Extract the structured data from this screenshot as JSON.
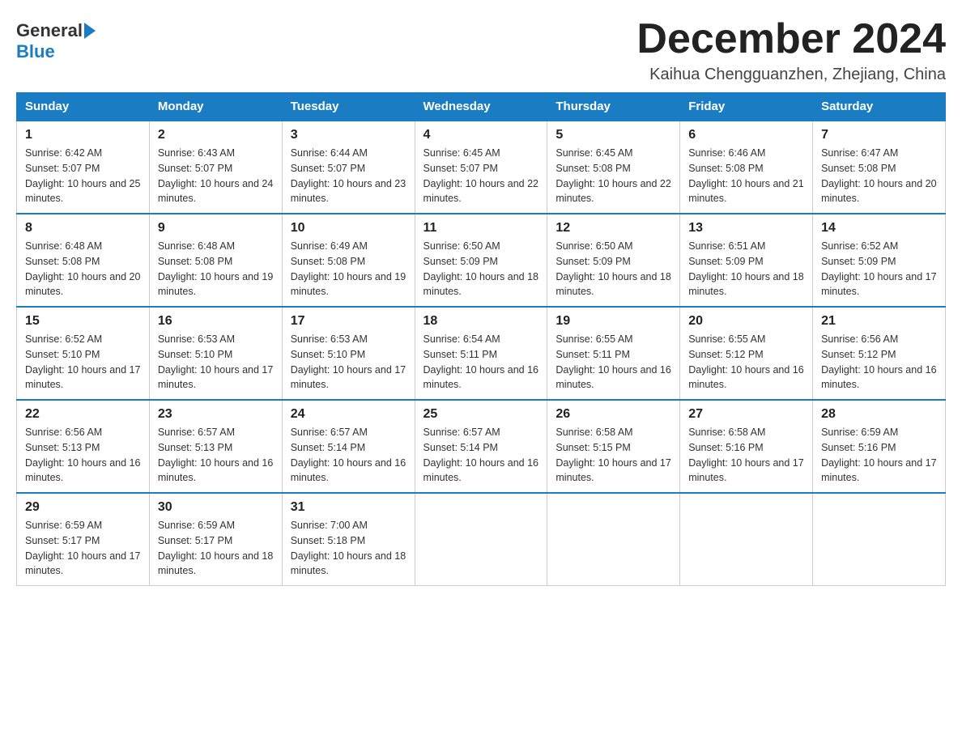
{
  "header": {
    "logo_general": "General",
    "logo_blue": "Blue",
    "month_title": "December 2024",
    "location": "Kaihua Chengguanzhen, Zhejiang, China"
  },
  "days_of_week": [
    "Sunday",
    "Monday",
    "Tuesday",
    "Wednesday",
    "Thursday",
    "Friday",
    "Saturday"
  ],
  "weeks": [
    [
      {
        "day": "1",
        "sunrise": "6:42 AM",
        "sunset": "5:07 PM",
        "daylight": "10 hours and 25 minutes."
      },
      {
        "day": "2",
        "sunrise": "6:43 AM",
        "sunset": "5:07 PM",
        "daylight": "10 hours and 24 minutes."
      },
      {
        "day": "3",
        "sunrise": "6:44 AM",
        "sunset": "5:07 PM",
        "daylight": "10 hours and 23 minutes."
      },
      {
        "day": "4",
        "sunrise": "6:45 AM",
        "sunset": "5:07 PM",
        "daylight": "10 hours and 22 minutes."
      },
      {
        "day": "5",
        "sunrise": "6:45 AM",
        "sunset": "5:08 PM",
        "daylight": "10 hours and 22 minutes."
      },
      {
        "day": "6",
        "sunrise": "6:46 AM",
        "sunset": "5:08 PM",
        "daylight": "10 hours and 21 minutes."
      },
      {
        "day": "7",
        "sunrise": "6:47 AM",
        "sunset": "5:08 PM",
        "daylight": "10 hours and 20 minutes."
      }
    ],
    [
      {
        "day": "8",
        "sunrise": "6:48 AM",
        "sunset": "5:08 PM",
        "daylight": "10 hours and 20 minutes."
      },
      {
        "day": "9",
        "sunrise": "6:48 AM",
        "sunset": "5:08 PM",
        "daylight": "10 hours and 19 minutes."
      },
      {
        "day": "10",
        "sunrise": "6:49 AM",
        "sunset": "5:08 PM",
        "daylight": "10 hours and 19 minutes."
      },
      {
        "day": "11",
        "sunrise": "6:50 AM",
        "sunset": "5:09 PM",
        "daylight": "10 hours and 18 minutes."
      },
      {
        "day": "12",
        "sunrise": "6:50 AM",
        "sunset": "5:09 PM",
        "daylight": "10 hours and 18 minutes."
      },
      {
        "day": "13",
        "sunrise": "6:51 AM",
        "sunset": "5:09 PM",
        "daylight": "10 hours and 18 minutes."
      },
      {
        "day": "14",
        "sunrise": "6:52 AM",
        "sunset": "5:09 PM",
        "daylight": "10 hours and 17 minutes."
      }
    ],
    [
      {
        "day": "15",
        "sunrise": "6:52 AM",
        "sunset": "5:10 PM",
        "daylight": "10 hours and 17 minutes."
      },
      {
        "day": "16",
        "sunrise": "6:53 AM",
        "sunset": "5:10 PM",
        "daylight": "10 hours and 17 minutes."
      },
      {
        "day": "17",
        "sunrise": "6:53 AM",
        "sunset": "5:10 PM",
        "daylight": "10 hours and 17 minutes."
      },
      {
        "day": "18",
        "sunrise": "6:54 AM",
        "sunset": "5:11 PM",
        "daylight": "10 hours and 16 minutes."
      },
      {
        "day": "19",
        "sunrise": "6:55 AM",
        "sunset": "5:11 PM",
        "daylight": "10 hours and 16 minutes."
      },
      {
        "day": "20",
        "sunrise": "6:55 AM",
        "sunset": "5:12 PM",
        "daylight": "10 hours and 16 minutes."
      },
      {
        "day": "21",
        "sunrise": "6:56 AM",
        "sunset": "5:12 PM",
        "daylight": "10 hours and 16 minutes."
      }
    ],
    [
      {
        "day": "22",
        "sunrise": "6:56 AM",
        "sunset": "5:13 PM",
        "daylight": "10 hours and 16 minutes."
      },
      {
        "day": "23",
        "sunrise": "6:57 AM",
        "sunset": "5:13 PM",
        "daylight": "10 hours and 16 minutes."
      },
      {
        "day": "24",
        "sunrise": "6:57 AM",
        "sunset": "5:14 PM",
        "daylight": "10 hours and 16 minutes."
      },
      {
        "day": "25",
        "sunrise": "6:57 AM",
        "sunset": "5:14 PM",
        "daylight": "10 hours and 16 minutes."
      },
      {
        "day": "26",
        "sunrise": "6:58 AM",
        "sunset": "5:15 PM",
        "daylight": "10 hours and 17 minutes."
      },
      {
        "day": "27",
        "sunrise": "6:58 AM",
        "sunset": "5:16 PM",
        "daylight": "10 hours and 17 minutes."
      },
      {
        "day": "28",
        "sunrise": "6:59 AM",
        "sunset": "5:16 PM",
        "daylight": "10 hours and 17 minutes."
      }
    ],
    [
      {
        "day": "29",
        "sunrise": "6:59 AM",
        "sunset": "5:17 PM",
        "daylight": "10 hours and 17 minutes."
      },
      {
        "day": "30",
        "sunrise": "6:59 AM",
        "sunset": "5:17 PM",
        "daylight": "10 hours and 18 minutes."
      },
      {
        "day": "31",
        "sunrise": "7:00 AM",
        "sunset": "5:18 PM",
        "daylight": "10 hours and 18 minutes."
      },
      null,
      null,
      null,
      null
    ]
  ]
}
